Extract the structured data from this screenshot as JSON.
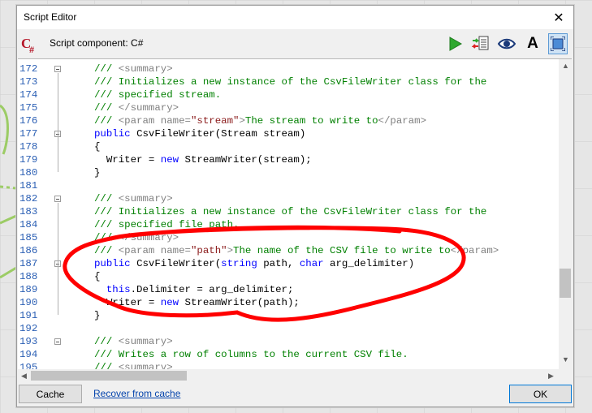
{
  "window": {
    "title": "Script Editor",
    "close_glyph": "✕"
  },
  "toolbar": {
    "component_label": "Script component: C#",
    "icons": [
      "run-icon",
      "compile-icon",
      "preview-icon",
      "font-icon",
      "fullscreen-icon"
    ],
    "font_glyph": "A"
  },
  "editor": {
    "lines": [
      {
        "n": "172",
        "fold": true,
        "parts": [
          [
            "com",
            "/// "
          ],
          [
            "tag",
            "<summary>"
          ]
        ]
      },
      {
        "n": "173",
        "parts": [
          [
            "com",
            "/// Initializes a new instance of the CsvFileWriter class for the"
          ]
        ]
      },
      {
        "n": "174",
        "parts": [
          [
            "com",
            "/// specified stream."
          ]
        ]
      },
      {
        "n": "175",
        "parts": [
          [
            "com",
            "/// "
          ],
          [
            "tag",
            "</summary>"
          ]
        ]
      },
      {
        "n": "176",
        "parts": [
          [
            "com",
            "/// "
          ],
          [
            "tag",
            "<param name="
          ],
          [
            "str",
            "\"stream\""
          ],
          [
            "tag",
            ">"
          ],
          [
            "com",
            "The stream to write to"
          ],
          [
            "tag",
            "</param>"
          ]
        ]
      },
      {
        "n": "177",
        "fold": true,
        "parts": [
          [
            "kw",
            "public "
          ],
          [
            "pl",
            "CsvFileWriter(Stream stream)"
          ]
        ]
      },
      {
        "n": "178",
        "parts": [
          [
            "pl",
            "{"
          ]
        ]
      },
      {
        "n": "179",
        "parts": [
          [
            "pl",
            "  Writer = "
          ],
          [
            "kw",
            "new "
          ],
          [
            "pl",
            "StreamWriter(stream);"
          ]
        ]
      },
      {
        "n": "180",
        "parts": [
          [
            "pl",
            "}"
          ]
        ]
      },
      {
        "n": "181",
        "parts": []
      },
      {
        "n": "182",
        "fold": true,
        "parts": [
          [
            "com",
            "/// "
          ],
          [
            "tag",
            "<summary>"
          ]
        ]
      },
      {
        "n": "183",
        "parts": [
          [
            "com",
            "/// Initializes a new instance of the CsvFileWriter class for the"
          ]
        ]
      },
      {
        "n": "184",
        "parts": [
          [
            "com",
            "/// specified file path."
          ]
        ]
      },
      {
        "n": "185",
        "parts": [
          [
            "com",
            "/// "
          ],
          [
            "tag",
            "</summary>"
          ]
        ]
      },
      {
        "n": "186",
        "parts": [
          [
            "com",
            "/// "
          ],
          [
            "tag",
            "<param name="
          ],
          [
            "str",
            "\"path\""
          ],
          [
            "tag",
            ">"
          ],
          [
            "com",
            "The name of the CSV file to write to"
          ],
          [
            "tag",
            "</param>"
          ]
        ]
      },
      {
        "n": "187",
        "fold": true,
        "parts": [
          [
            "kw",
            "public "
          ],
          [
            "pl",
            "CsvFileWriter("
          ],
          [
            "kw",
            "string "
          ],
          [
            "pl",
            "path, "
          ],
          [
            "kw",
            "char "
          ],
          [
            "pl",
            "arg_delimiter)"
          ]
        ]
      },
      {
        "n": "188",
        "parts": [
          [
            "pl",
            "{"
          ]
        ]
      },
      {
        "n": "189",
        "parts": [
          [
            "pl",
            "  "
          ],
          [
            "kw",
            "this"
          ],
          [
            "pl",
            ".Delimiter = arg_delimiter;"
          ]
        ]
      },
      {
        "n": "190",
        "parts": [
          [
            "pl",
            "  Writer = "
          ],
          [
            "kw",
            "new "
          ],
          [
            "pl",
            "StreamWriter(path);"
          ]
        ]
      },
      {
        "n": "191",
        "parts": [
          [
            "pl",
            "}"
          ]
        ]
      },
      {
        "n": "192",
        "parts": []
      },
      {
        "n": "193",
        "fold": true,
        "parts": [
          [
            "com",
            "/// "
          ],
          [
            "tag",
            "<summary>"
          ]
        ]
      },
      {
        "n": "194",
        "parts": [
          [
            "com",
            "/// Writes a row of columns to the current CSV file."
          ]
        ]
      },
      {
        "n": "195",
        "parts": [
          [
            "com",
            "/// "
          ],
          [
            "tag",
            "<summary>"
          ]
        ]
      }
    ],
    "annotation_color": "#ff0000"
  },
  "footer": {
    "cache_label": "Cache",
    "recover_label": "Recover from cache",
    "ok_label": "OK"
  }
}
